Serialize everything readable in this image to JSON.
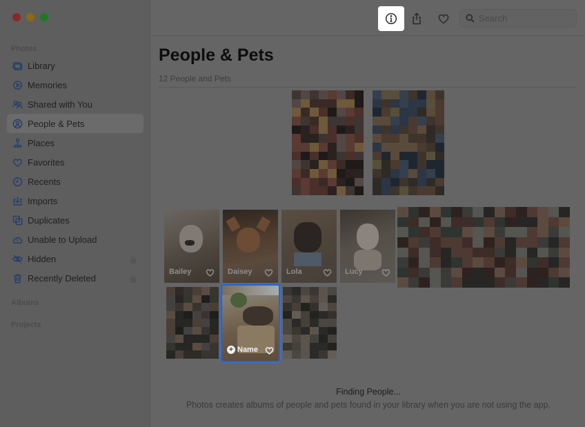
{
  "window": {
    "traffic_lights": [
      "close",
      "minimize",
      "maximize"
    ]
  },
  "sidebar": {
    "section_photos": "Photos",
    "items": [
      {
        "label": "Library",
        "icon": "library-icon"
      },
      {
        "label": "Memories",
        "icon": "memories-icon"
      },
      {
        "label": "Shared with You",
        "icon": "shared-icon"
      },
      {
        "label": "People & Pets",
        "icon": "people-icon",
        "active": true
      },
      {
        "label": "Places",
        "icon": "places-icon"
      },
      {
        "label": "Favorites",
        "icon": "heart-icon"
      },
      {
        "label": "Recents",
        "icon": "clock-icon"
      },
      {
        "label": "Imports",
        "icon": "import-icon"
      },
      {
        "label": "Duplicates",
        "icon": "duplicates-icon"
      },
      {
        "label": "Unable to Upload",
        "icon": "cloud-icon"
      },
      {
        "label": "Hidden",
        "icon": "eye-icon",
        "locked": true
      },
      {
        "label": "Recently Deleted",
        "icon": "trash-icon",
        "locked": true
      }
    ],
    "section_albums": "Albums",
    "section_projects": "Projects"
  },
  "toolbar": {
    "info_icon": "info-icon",
    "share_icon": "share-icon",
    "favorite_icon": "heart-icon",
    "search_placeholder": "Search"
  },
  "main": {
    "title": "People & Pets",
    "subtitle": "12 People and Pets",
    "pets": [
      {
        "name": "Bailey"
      },
      {
        "name": "Daisey"
      },
      {
        "name": "Lola"
      },
      {
        "name": "Lucy"
      }
    ],
    "unnamed_tile_label": "Name",
    "finding_title": "Finding People...",
    "finding_description": "Photos creates albums of people and pets found in your library when you are not using the app."
  }
}
